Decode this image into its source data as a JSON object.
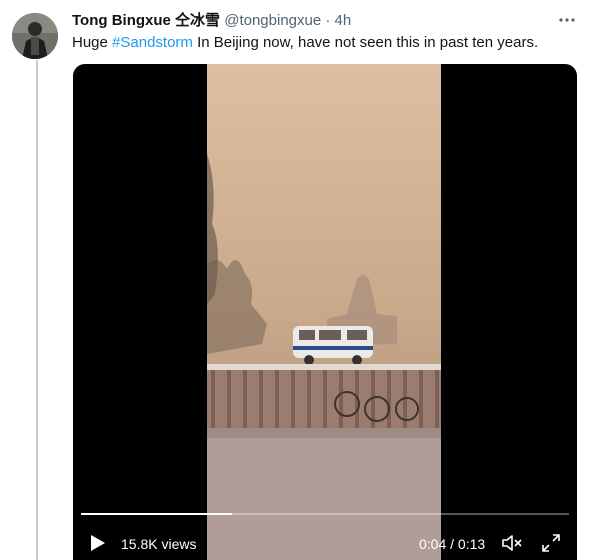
{
  "tweet": {
    "author_name": "Tong Bingxue 仝冰雪",
    "handle": "@tongbingxue",
    "separator": "·",
    "time_ago": "4h",
    "text_before": "Huge ",
    "hashtag": "#Sandstorm",
    "text_after": " In Beijing now, have not seen this in past ten years."
  },
  "video": {
    "views": "15.8K views",
    "time_current": "0:04",
    "time_separator": "/",
    "time_total": "0:13",
    "progress": 0.31
  },
  "colors": {
    "link": "#1d9bf0",
    "text": "#0f1419",
    "secondary": "#536471",
    "thread_line": "#c4cfd6",
    "video_letterbox": "#000000"
  },
  "icons": {
    "more": "more-horizontal-icon",
    "play": "play-icon",
    "mute": "volume-muted-icon",
    "fullscreen": "fullscreen-icon"
  }
}
